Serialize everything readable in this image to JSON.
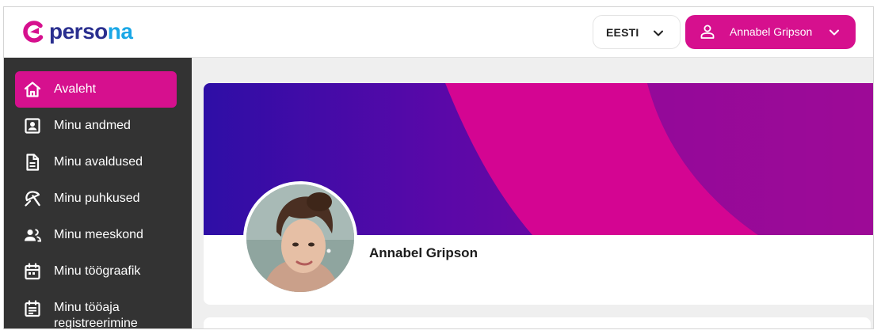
{
  "brand": {
    "name_part1": "perso",
    "name_part2": "na",
    "logo_icon": "persona-logo-icon"
  },
  "header": {
    "language": {
      "label": "EESTI",
      "icon": "chevron-down-icon"
    },
    "user": {
      "name": "Annabel Gripson",
      "icon": "user-icon",
      "chevron": "chevron-down-icon"
    }
  },
  "sidebar": {
    "items": [
      {
        "label": "Avaleht",
        "icon": "home-icon",
        "active": true
      },
      {
        "label": "Minu andmed",
        "icon": "profile-card-icon",
        "active": false
      },
      {
        "label": "Minu avaldused",
        "icon": "document-icon",
        "active": false
      },
      {
        "label": "Minu puhkused",
        "icon": "beach-umbrella-icon",
        "active": false
      },
      {
        "label": "Minu meeskond",
        "icon": "team-icon",
        "active": false
      },
      {
        "label": "Minu töögraafik",
        "icon": "calendar-icon",
        "active": false
      },
      {
        "label_line1": "Minu tööaja",
        "label_line2": "registreerimine",
        "icon": "time-registration-icon",
        "active": false
      }
    ]
  },
  "profile": {
    "name": "Annabel Gripson",
    "avatar": "profile-photo"
  },
  "colors": {
    "accent": "#d6108e",
    "sidebar_bg": "#333333",
    "banner_start": "#3a0fa8",
    "banner_end": "#9a0a96",
    "logo_dark": "#2a2f8f",
    "logo_light": "#1aa7e6"
  }
}
